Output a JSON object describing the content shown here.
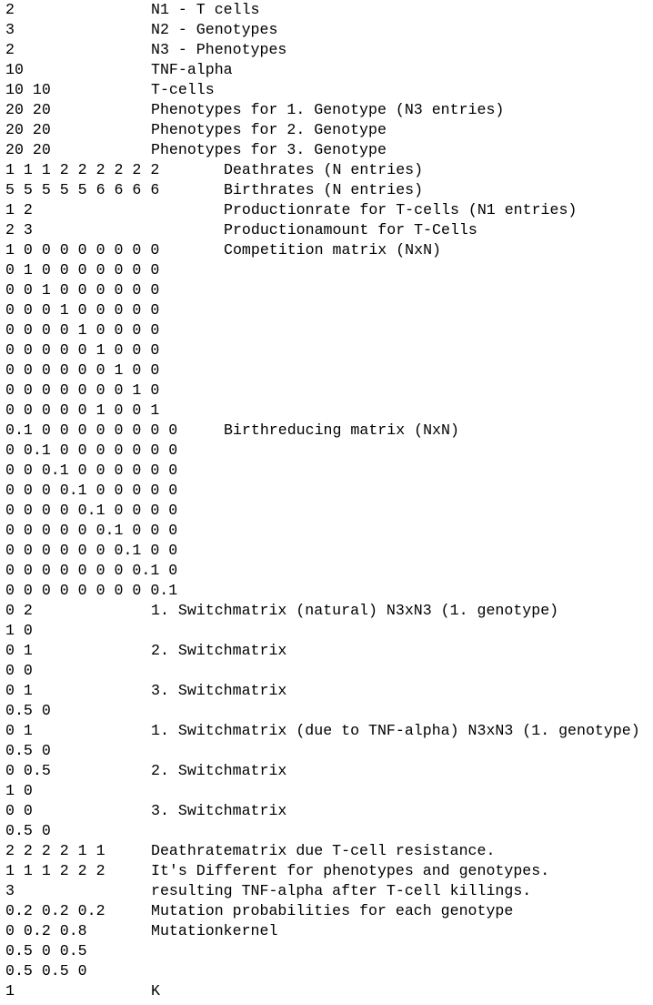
{
  "lines": [
    {
      "value": "2",
      "desc": "N1 - T cells"
    },
    {
      "value": "3",
      "desc": "N2 - Genotypes"
    },
    {
      "value": "2",
      "desc": "N3 - Phenotypes"
    },
    {
      "value": "10",
      "desc": "TNF-alpha"
    },
    {
      "value": "10 10",
      "desc": "T-cells"
    },
    {
      "value": "20 20",
      "desc": "Phenotypes for 1. Genotype (N3 entries)"
    },
    {
      "value": "20 20",
      "desc": "Phenotypes for 2. Genotype"
    },
    {
      "value": "20 20",
      "desc": "Phenotypes for 3. Genotype"
    },
    {
      "value": "1 1 1 2 2 2 2 2 2",
      "desc": "Deathrates (N entries)"
    },
    {
      "value": "5 5 5 5 5 6 6 6 6",
      "desc": "Birthrates (N entries)"
    },
    {
      "value": "1 2",
      "desc": "Productionrate for T-cells (N1 entries)"
    },
    {
      "value": "2 3",
      "desc": "Productionamount for T-Cells"
    },
    {
      "value": "1 0 0 0 0 0 0 0 0",
      "desc": "Competition matrix (NxN)"
    },
    {
      "value": "0 1 0 0 0 0 0 0 0",
      "desc": ""
    },
    {
      "value": "0 0 1 0 0 0 0 0 0",
      "desc": ""
    },
    {
      "value": "0 0 0 1 0 0 0 0 0",
      "desc": ""
    },
    {
      "value": "0 0 0 0 1 0 0 0 0",
      "desc": ""
    },
    {
      "value": "0 0 0 0 0 1 0 0 0",
      "desc": ""
    },
    {
      "value": "0 0 0 0 0 0 1 0 0",
      "desc": ""
    },
    {
      "value": "0 0 0 0 0 0 0 1 0",
      "desc": ""
    },
    {
      "value": "0 0 0 0 0 1 0 0 1",
      "desc": ""
    },
    {
      "value": "0.1 0 0 0 0 0 0 0 0",
      "desc": "Birthreducing matrix (NxN)"
    },
    {
      "value": "0 0.1 0 0 0 0 0 0 0",
      "desc": ""
    },
    {
      "value": "0 0 0.1 0 0 0 0 0 0",
      "desc": ""
    },
    {
      "value": "0 0 0 0.1 0 0 0 0 0",
      "desc": ""
    },
    {
      "value": "0 0 0 0 0.1 0 0 0 0",
      "desc": ""
    },
    {
      "value": "0 0 0 0 0 0.1 0 0 0",
      "desc": ""
    },
    {
      "value": "0 0 0 0 0 0 0.1 0 0",
      "desc": ""
    },
    {
      "value": "0 0 0 0 0 0 0 0.1 0",
      "desc": ""
    },
    {
      "value": "0 0 0 0 0 0 0 0 0.1",
      "desc": ""
    },
    {
      "value": "0 2",
      "desc": "1. Switchmatrix (natural) N3xN3 (1. genotype)"
    },
    {
      "value": "1 0",
      "desc": ""
    },
    {
      "value": "0 1",
      "desc": "2. Switchmatrix"
    },
    {
      "value": "0 0",
      "desc": ""
    },
    {
      "value": "0 1",
      "desc": "3. Switchmatrix"
    },
    {
      "value": "0.5 0",
      "desc": ""
    },
    {
      "value": "0 1",
      "desc": "1. Switchmatrix (due to TNF-alpha) N3xN3 (1. genotype)"
    },
    {
      "value": "0.5 0",
      "desc": ""
    },
    {
      "value": "0 0.5",
      "desc": "2. Switchmatrix"
    },
    {
      "value": "1 0",
      "desc": ""
    },
    {
      "value": "0 0",
      "desc": "3. Switchmatrix"
    },
    {
      "value": "0.5 0",
      "desc": ""
    },
    {
      "value": "2 2 2 2 1 1",
      "desc": "Deathratematrix due T-cell resistance."
    },
    {
      "value": "1 1 1 2 2 2",
      "desc": "It's Different for phenotypes and genotypes."
    },
    {
      "value": "3",
      "desc": "resulting TNF-alpha after T-cell killings."
    },
    {
      "value": "0.2 0.2 0.2",
      "desc": "Mutation probabilities for each genotype"
    },
    {
      "value": "0 0.2 0.8",
      "desc": "Mutationkernel"
    },
    {
      "value": "0.5 0 0.5",
      "desc": ""
    },
    {
      "value": "0.5 0.5 0",
      "desc": ""
    },
    {
      "value": "1",
      "desc": "K"
    }
  ]
}
